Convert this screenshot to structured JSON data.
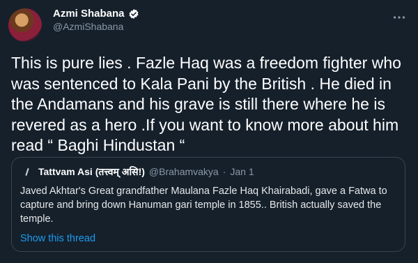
{
  "author": {
    "name": "Azmi Shabana",
    "handle": "@AzmiShabana",
    "avatar_icon": "user-avatar",
    "verified_icon": "verified-badge-icon"
  },
  "menu_icon": "more-options-icon",
  "tweet": {
    "text": "This is pure lies . Fazle Haq was a freedom fighter who was sentenced to Kala Pani by the British . He died in the Andamans and his grave is still there where he is revered as a hero .If you want to know more about him read “ Baghi Hindustan “"
  },
  "quote": {
    "name": "Tattvam Asi (तत्त्वम् असि!)",
    "handle": "@Brahamvakya",
    "separator": "·",
    "date": "Jan 1",
    "text": "Javed Akhtar's Great grandfather Maulana Fazle Haq Khairabadi, gave a Fatwa to capture and bring down Hanuman gari temple in 1855.. British actually saved the temple.",
    "show_thread": "Show this thread"
  },
  "colors": {
    "background": "#15202b",
    "accent": "#1d9bf0",
    "muted": "#8b98a5",
    "border": "#38444d"
  }
}
